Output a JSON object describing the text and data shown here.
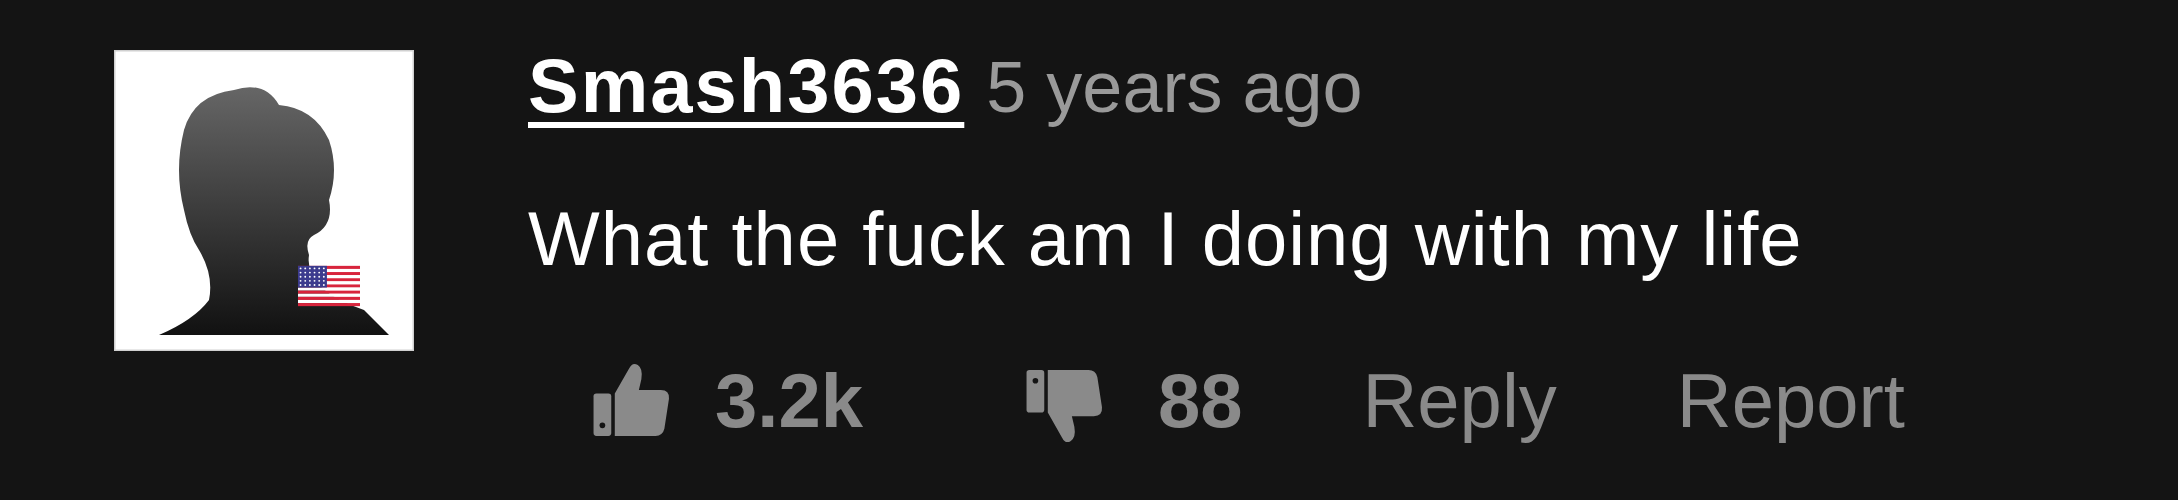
{
  "comment": {
    "author": "Smash3636",
    "time": "5 years ago",
    "text": "What the fuck am I doing with my life",
    "likes": "3.2k",
    "dislikes": "88",
    "actions": [
      "Reply",
      "Report"
    ]
  }
}
